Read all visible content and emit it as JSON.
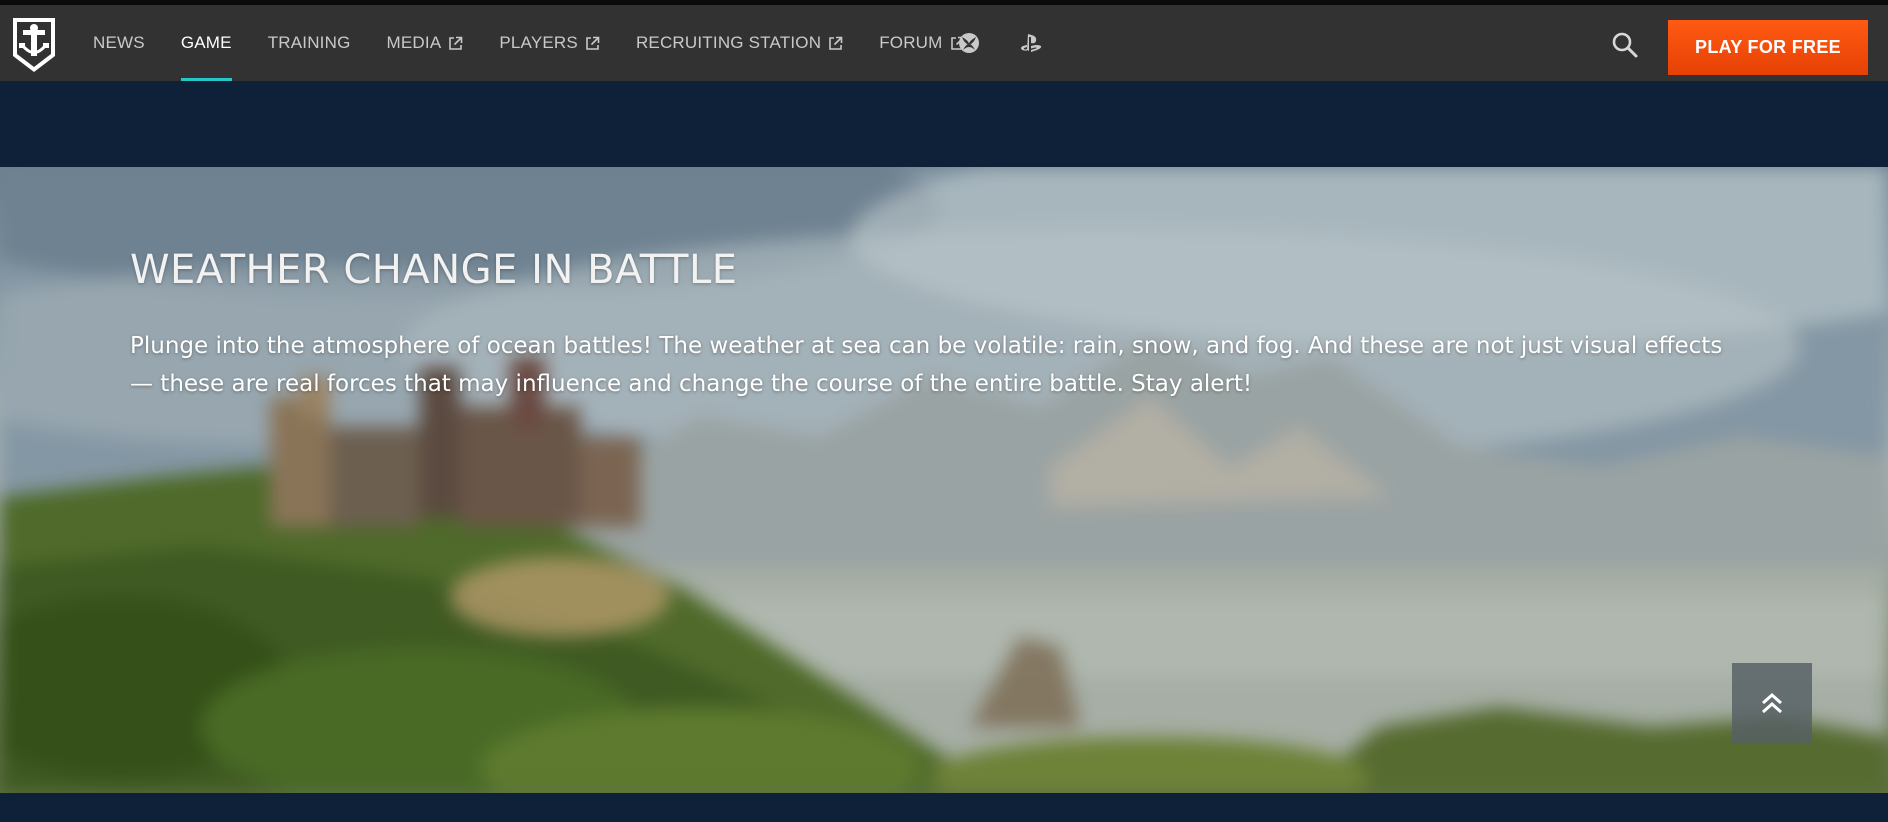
{
  "header": {
    "nav": [
      {
        "label": "News",
        "external": false,
        "active": false
      },
      {
        "label": "Game",
        "external": false,
        "active": true
      },
      {
        "label": "Training",
        "external": false,
        "active": false
      },
      {
        "label": "Media",
        "external": true,
        "active": false
      },
      {
        "label": "Players",
        "external": true,
        "active": false
      },
      {
        "label": "Recruiting Station",
        "external": true,
        "active": false
      },
      {
        "label": "Forum",
        "external": true,
        "active": false
      }
    ],
    "platforms": [
      "xbox-icon",
      "playstation-icon"
    ],
    "play_label": "Play for free",
    "colors": {
      "bar": "#323232",
      "active_underline": "#27c6c9",
      "play_button": "#ff5a13"
    }
  },
  "hero": {
    "title": "Weather Change in Battle",
    "text": "Plunge into the atmosphere of ocean battles! The weather at sea can be volatile: rain, snow, and fog. And these are not just visual effects — these are real forces that may influence and change the course of the entire battle. Stay alert!"
  },
  "page": {
    "background": "#0f2138"
  }
}
